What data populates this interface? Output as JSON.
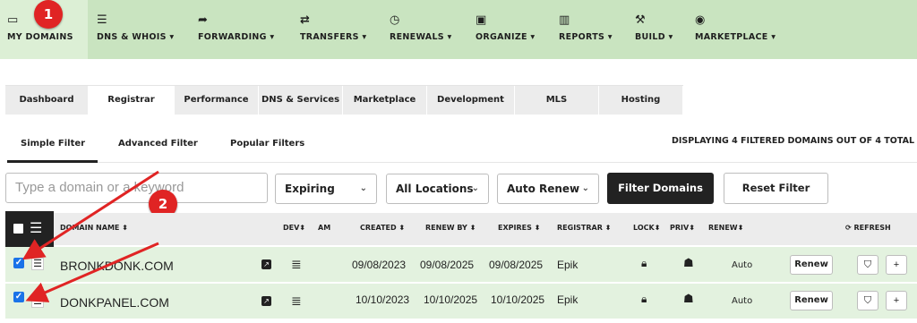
{
  "nav": {
    "items": [
      {
        "label": "MY DOMAINS",
        "icon": "browser-icon"
      },
      {
        "label": "DNS & WHOIS ▾",
        "icon": "server-list-icon"
      },
      {
        "label": "FORWARDING ▾",
        "icon": "forward-arrow-icon"
      },
      {
        "label": "TRANSFERS ▾",
        "icon": "transfer-arrows-icon"
      },
      {
        "label": "RENEWALS ▾",
        "icon": "clock-icon"
      },
      {
        "label": "ORGANIZE ▾",
        "icon": "briefcase-icon"
      },
      {
        "label": "REPORTS ▾",
        "icon": "bar-chart-icon"
      },
      {
        "label": "BUILD ▾",
        "icon": "wrench-icon"
      },
      {
        "label": "MARKETPLACE ▾",
        "icon": "target-icon"
      }
    ]
  },
  "annotations": {
    "badge1": "1",
    "badge2": "2"
  },
  "tabs": [
    "Dashboard",
    "Registrar",
    "Performance",
    "DNS & Services",
    "Marketplace",
    "Development",
    "MLS",
    "Hosting"
  ],
  "subtabs": [
    "Simple Filter",
    "Advanced Filter",
    "Popular Filters"
  ],
  "display_count": "DISPLAYING 4 FILTERED DOMAINS OUT OF 4 TOTAL",
  "filters": {
    "search_placeholder": "Type a domain or a keyword",
    "expiring": "Expiring",
    "locations": "All Locations",
    "auto_renew": "Auto Renew",
    "filter_button": "Filter Domains",
    "reset_button": "Reset Filter"
  },
  "table": {
    "headers": {
      "domain_name": "DOMAIN NAME ⬍",
      "dev": "DEV⬍",
      "am": "AM",
      "created": "CREATED ⬍",
      "renew_by": "RENEW BY ⬍",
      "expires": "EXPIRES ⬍",
      "registrar": "REGISTRAR ⬍",
      "lock": "LOCK⬍",
      "priv": "PRIV⬍",
      "renew": "RENEW⬍",
      "refresh": "⟳ REFRESH"
    },
    "rows": [
      {
        "domain": "BRONKDONK.COM",
        "created": "09/08/2023",
        "renew_by": "09/08/2025",
        "expires": "09/08/2025",
        "registrar": "Epik",
        "auto": "Auto",
        "renew_btn": "Renew"
      },
      {
        "domain": "DONKPANEL.COM",
        "created": "10/10/2023",
        "renew_by": "10/10/2025",
        "expires": "10/10/2025",
        "registrar": "Epik",
        "auto": "Auto",
        "renew_btn": "Renew"
      }
    ]
  },
  "colors": {
    "nav_bg": "#c9e4c0",
    "row_bg": "#e3f2df",
    "badge": "#e02424",
    "dark_button": "#222222"
  }
}
